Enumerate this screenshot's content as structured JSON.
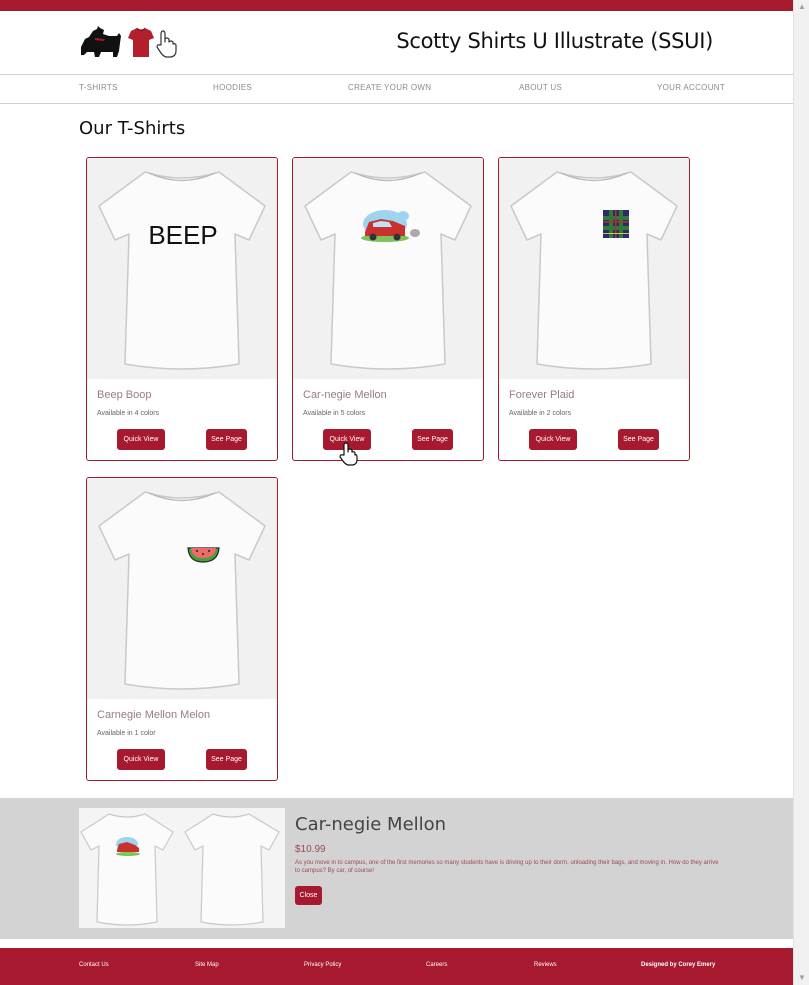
{
  "site": {
    "title": "Scotty Shirts U Illustrate (SSUI)",
    "accent_color": "#a6192e",
    "logo_icons": [
      "scottie-dog-icon",
      "shirt-icon",
      "pointing-hand-icon"
    ]
  },
  "nav": {
    "items": [
      {
        "label": "T-SHIRTS"
      },
      {
        "label": "HOODIES"
      },
      {
        "label": "CREATE YOUR OWN"
      },
      {
        "label": "ABOUT US"
      },
      {
        "label": "YOUR ACCOUNT"
      }
    ]
  },
  "page": {
    "heading": "Our T-Shirts"
  },
  "products": [
    {
      "name": "Beep Boop",
      "availability": "Available in 4 colors",
      "print_text": "BEEP",
      "design": "text-beep",
      "quick_view_label": "Quick View",
      "see_page_label": "See Page"
    },
    {
      "name": "Car-negie Mellon",
      "availability": "Available in 5 colors",
      "design": "car-graphic",
      "quick_view_label": "Quick View",
      "see_page_label": "See Page"
    },
    {
      "name": "Forever Plaid",
      "availability": "Available in 2 colors",
      "design": "plaid-pocket",
      "quick_view_label": "Quick View",
      "see_page_label": "See Page"
    },
    {
      "name": "Carnegie Mellon Melon",
      "availability": "Available in 1 color",
      "design": "watermelon-slice",
      "quick_view_label": "Quick View",
      "see_page_label": "See Page"
    }
  ],
  "quick_view": {
    "title": "Car-negie Mellon",
    "price": "$10.99",
    "description": "As you move in to campus, one of the first memories so many students have is driving up to their dorm, unloading their bags, and moving in. How do they arrive to campus? By car, of course!",
    "close_label": "Close"
  },
  "footer": {
    "links": [
      {
        "label": "Contact Us"
      },
      {
        "label": "Site Map"
      },
      {
        "label": "Privacy Policy"
      },
      {
        "label": "Careers"
      },
      {
        "label": "Reviews"
      }
    ],
    "credit": "Designed by Corey Emery"
  }
}
